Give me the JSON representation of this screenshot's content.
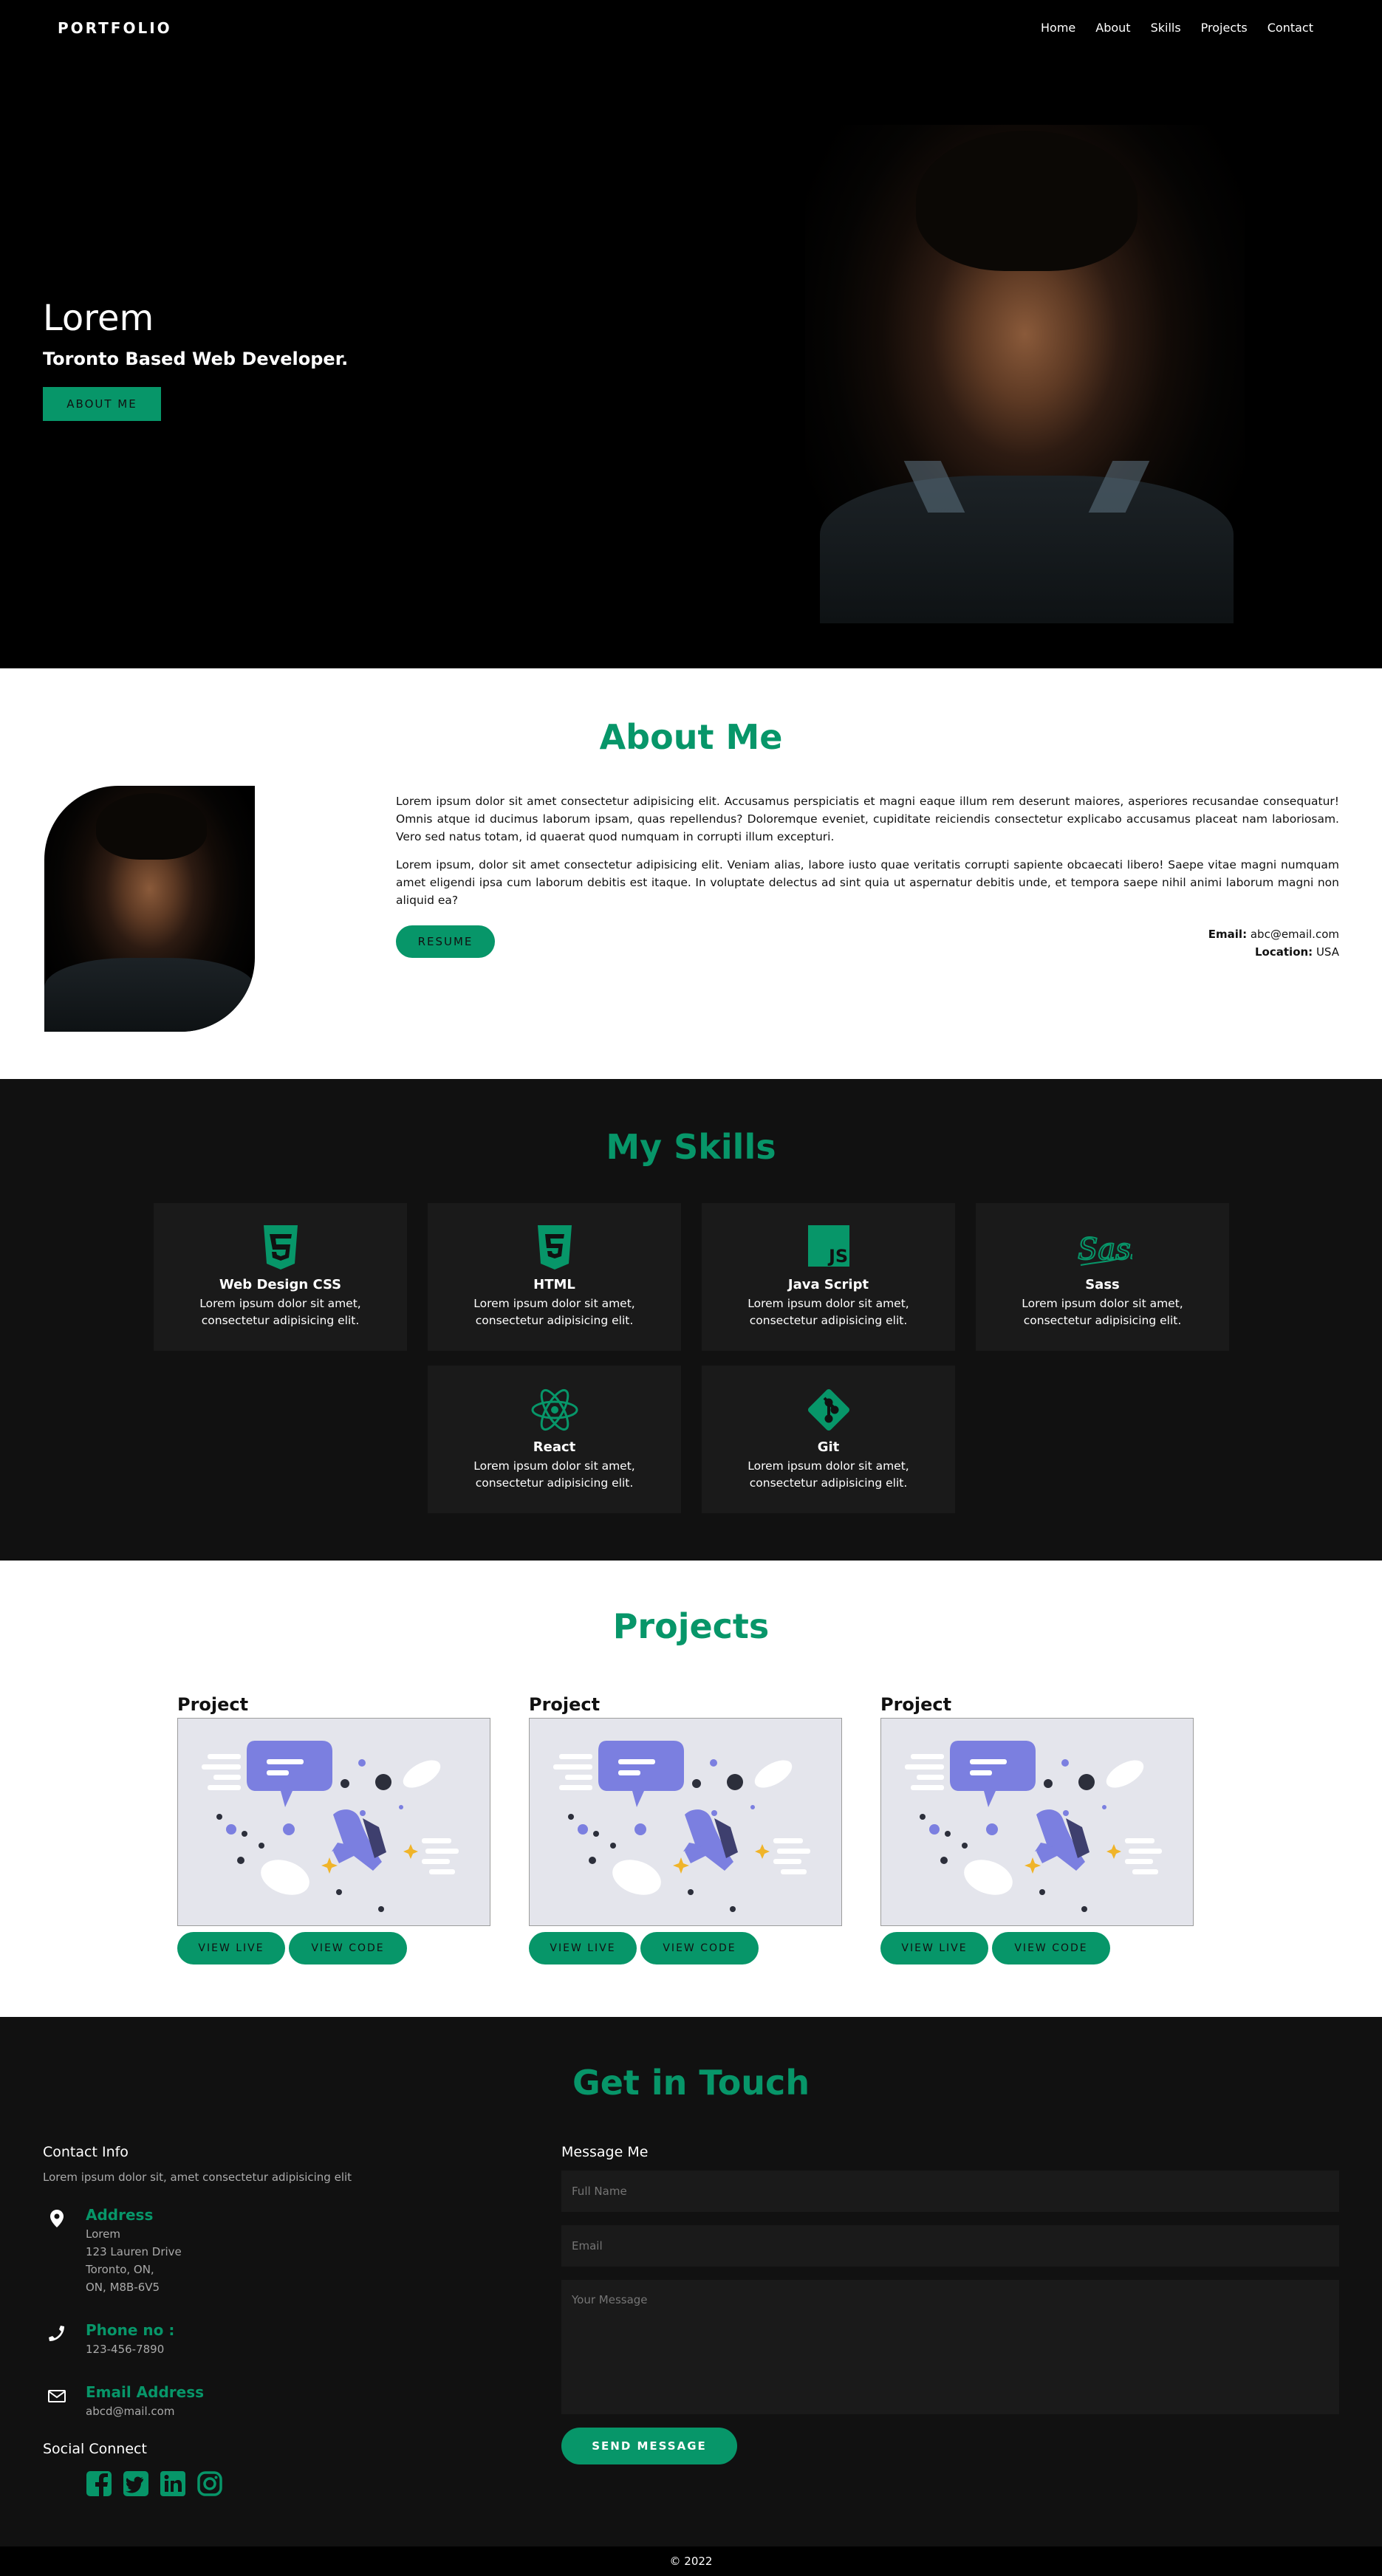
{
  "nav": {
    "logo": "PORTFOLIO",
    "links": [
      "Home",
      "About",
      "Skills",
      "Projects",
      "Contact"
    ]
  },
  "hero": {
    "name": "Lorem",
    "tagline": "Toronto Based Web Developer.",
    "button": "ABOUT ME"
  },
  "about": {
    "title": "About Me",
    "p1": "Lorem ipsum dolor sit amet consectetur adipisicing elit. Accusamus perspiciatis et magni eaque illum rem deserunt maiores, asperiores recusandae consequatur! Omnis atque id ducimus laborum ipsam, quas repellendus? Doloremque eveniet, cupiditate reiciendis consectetur explicabo accusamus placeat nam laboriosam. Vero sed natus totam, id quaerat quod numquam in corrupti illum excepturi.",
    "p2": "Lorem ipsum, dolor sit amet consectetur adipisicing elit. Veniam alias, labore iusto quae veritatis corrupti sapiente obcaecati libero! Saepe vitae magni numquam amet eligendi ipsa cum laborum debitis est itaque. In voluptate delectus ad sint quia ut aspernatur debitis unde, et tempora saepe nihil animi laborum magni non aliquid ea?",
    "resume": "RESUME",
    "email_label": "Email:",
    "email": "abc@email.com",
    "location_label": "Location:",
    "location": "USA"
  },
  "skills": {
    "title": "My Skills",
    "items": [
      {
        "name": "Web Design CSS",
        "desc": "Lorem ipsum dolor sit amet, consectetur adipisicing elit.",
        "icon": "css3-icon"
      },
      {
        "name": "HTML",
        "desc": "Lorem ipsum dolor sit amet, consectetur adipisicing elit.",
        "icon": "html5-icon"
      },
      {
        "name": "Java Script",
        "desc": "Lorem ipsum dolor sit amet, consectetur adipisicing elit.",
        "icon": "js-icon"
      },
      {
        "name": "Sass",
        "desc": "Lorem ipsum dolor sit amet, consectetur adipisicing elit.",
        "icon": "sass-icon"
      },
      {
        "name": "React",
        "desc": "Lorem ipsum dolor sit amet, consectetur adipisicing elit.",
        "icon": "react-icon"
      },
      {
        "name": "Git",
        "desc": "Lorem ipsum dolor sit amet, consectetur adipisicing elit.",
        "icon": "git-icon"
      }
    ]
  },
  "projects": {
    "title": "Projects",
    "items": [
      {
        "name": "Project",
        "live": "VIEW LIVE",
        "code": "VIEW CODE"
      },
      {
        "name": "Project",
        "live": "VIEW LIVE",
        "code": "VIEW CODE"
      },
      {
        "name": "Project",
        "live": "VIEW LIVE",
        "code": "VIEW CODE"
      }
    ]
  },
  "contact": {
    "title": "Get in Touch",
    "info_title": "Contact Info",
    "info_sub": "Lorem ipsum dolor sit, amet consectetur adipisicing elit",
    "address_h": "Address",
    "address": [
      "Lorem",
      "123 Lauren Drive",
      "Toronto, ON,",
      "ON, M8B-6V5"
    ],
    "phone_h": "Phone no :",
    "phone": "123-456-7890",
    "email_h": "Email Address",
    "email": "abcd@mail.com",
    "social_title": "Social Connect",
    "message_title": "Message Me",
    "ph_name": "Full Name",
    "ph_email": "Email",
    "ph_message": "Your Message",
    "send": "Send Message"
  },
  "footer": {
    "copy": "© 2022"
  },
  "colors": {
    "accent": "#079669",
    "dark": "#111111",
    "card": "#1a1a1a"
  }
}
